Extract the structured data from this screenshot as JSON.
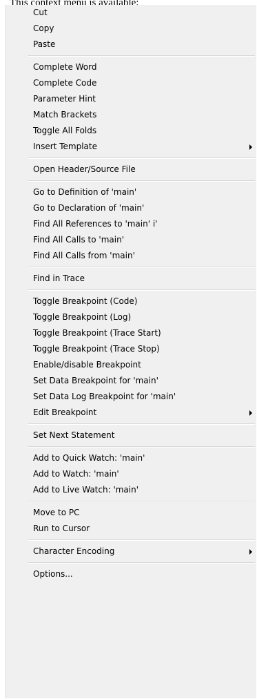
{
  "caption": "This context menu is available:",
  "menu": {
    "groups": [
      [
        "Cut",
        "Copy",
        "Paste"
      ],
      [
        "Complete Word",
        "Complete Code",
        "Parameter Hint",
        "Match Brackets",
        "Toggle All Folds",
        "Insert Template"
      ],
      [
        "Open Header/Source File"
      ],
      [
        "Go to Definition of 'main'",
        "Go to Declaration of 'main'",
        "Find All References to 'main'      i'",
        "Find All Calls to 'main'",
        "Find All Calls from 'main'"
      ],
      [
        "Find in Trace"
      ],
      [
        "Toggle Breakpoint (Code)",
        "Toggle Breakpoint (Log)",
        "Toggle Breakpoint (Trace Start)",
        "Toggle Breakpoint (Trace Stop)",
        "Enable/disable Breakpoint",
        "Set Data Breakpoint for 'main'",
        "Set Data Log Breakpoint for 'main'",
        "Edit Breakpoint"
      ],
      [
        "Set Next Statement"
      ],
      [
        "Add to Quick Watch:  'main'",
        "Add to Watch: 'main'",
        "Add to Live Watch: 'main'"
      ],
      [
        "Move to PC",
        "Run to Cursor"
      ],
      [
        "Character Encoding"
      ],
      [
        "Options..."
      ]
    ],
    "submenu_arrow": "chevron-right-icon"
  }
}
